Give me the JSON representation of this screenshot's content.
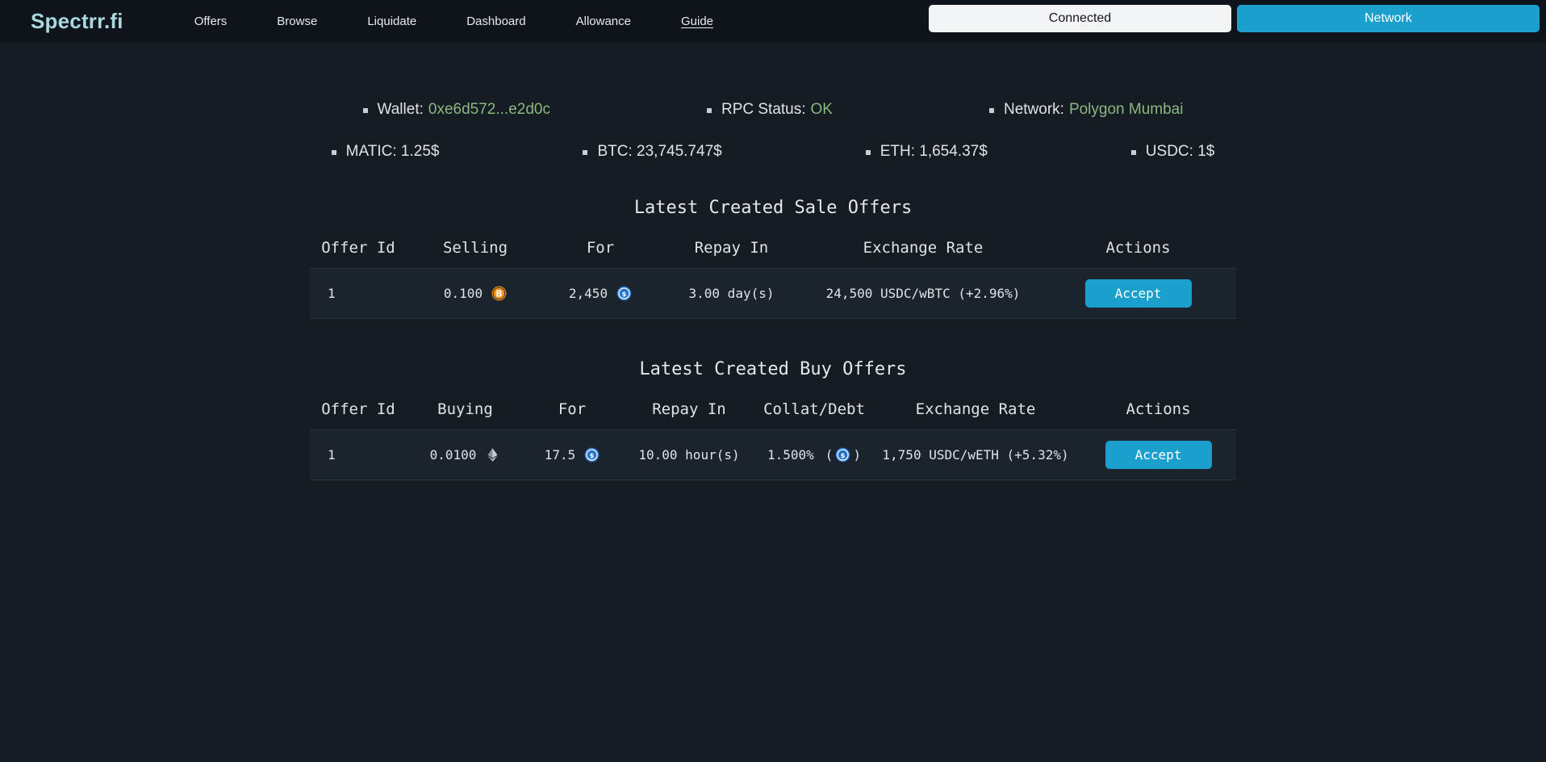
{
  "navbar": {
    "brand": "Spectrr.fi",
    "links": [
      {
        "label": "Offers",
        "active": false
      },
      {
        "label": "Browse",
        "active": false
      },
      {
        "label": "Liquidate",
        "active": false
      },
      {
        "label": "Dashboard",
        "active": false
      },
      {
        "label": "Allowance",
        "active": false
      },
      {
        "label": "Guide",
        "active": true
      }
    ],
    "connected_label": "Connected",
    "network_label": "Network",
    "accent_color": "#1ba0ce",
    "brand_color": "#a9d9de"
  },
  "status": {
    "row1": [
      {
        "label": "Wallet:",
        "value": "0xe6d572...e2d0c",
        "value_color": "#8ab87f"
      },
      {
        "label": "RPC Status:",
        "value": "OK",
        "value_color": "#8ab87f"
      },
      {
        "label": "Network:",
        "value": "Polygon Mumbai",
        "value_color": "#8ab87f"
      }
    ],
    "row2": [
      {
        "label": "MATIC: 1.25$"
      },
      {
        "label": "BTC: 23,745.747$"
      },
      {
        "label": "ETH: 1,654.37$"
      },
      {
        "label": "USDC: 1$"
      }
    ]
  },
  "sale_offers": {
    "title": "Latest Created Sale Offers",
    "headers": [
      "Offer Id",
      "Selling",
      "For",
      "Repay In",
      "Exchange Rate",
      "Actions"
    ],
    "rows": [
      {
        "offer_id": "1",
        "selling_amount": "0.100",
        "selling_icon": "wbtc-icon",
        "for_amount": "2,450",
        "for_icon": "usdc-icon",
        "repay_in": "3.00 day(s)",
        "exchange_rate": "24,500 USDC/wBTC (+2.96%)",
        "action_label": "Accept"
      }
    ]
  },
  "buy_offers": {
    "title": "Latest Created Buy Offers",
    "headers": [
      "Offer Id",
      "Buying",
      "For",
      "Repay In",
      "Collat/Debt",
      "Exchange Rate",
      "Actions"
    ],
    "rows": [
      {
        "offer_id": "1",
        "buying_amount": "0.0100",
        "buying_icon": "weth-icon",
        "for_amount": "17.5",
        "for_icon": "usdc-icon",
        "repay_in": "10.00 hour(s)",
        "collat_debt": "1.500%",
        "collat_paren_open": "(",
        "collat_paren_close": ")",
        "collat_icon": "usdc-icon",
        "exchange_rate": "1,750 USDC/wETH (+5.32%)",
        "action_label": "Accept"
      }
    ]
  }
}
